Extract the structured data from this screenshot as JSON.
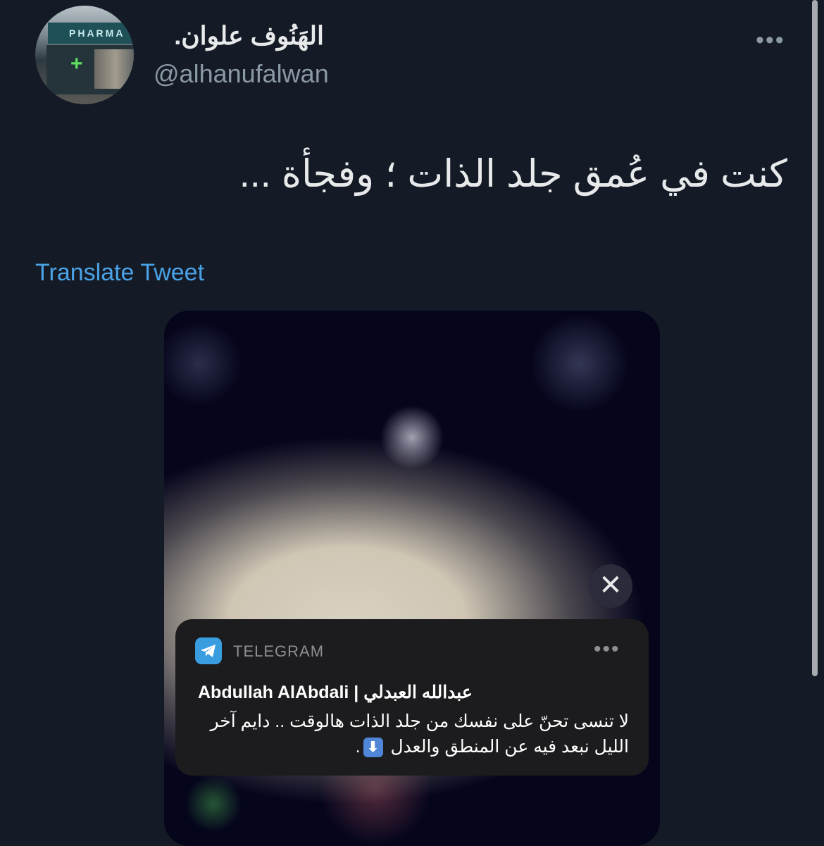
{
  "author": {
    "display_name": "الهَنُوف علوان.",
    "handle": "@alhanufalwan",
    "avatar_sign": "PHARMA"
  },
  "tweet": {
    "text": "كنت في عُمق جلد الذات ؛ وفجأة ...",
    "translate_label": "Translate Tweet",
    "more_label": "•••"
  },
  "media": {
    "close_label": "✕",
    "notification": {
      "app": "TELEGRAM",
      "more_label": "•••",
      "sender": "Abdullah AlAbdali | عبدالله العبدلي",
      "message": "لا تنسى تحنّ على نفسك من جلد الذات هالوقت .. دايم آخر الليل نبعد فيه عن المنطق والعدل",
      "message_end": ".",
      "emoji": "⬇"
    }
  },
  "colors": {
    "background": "#151b26",
    "link": "#4aa3e8",
    "telegram": "#3a9de0"
  }
}
